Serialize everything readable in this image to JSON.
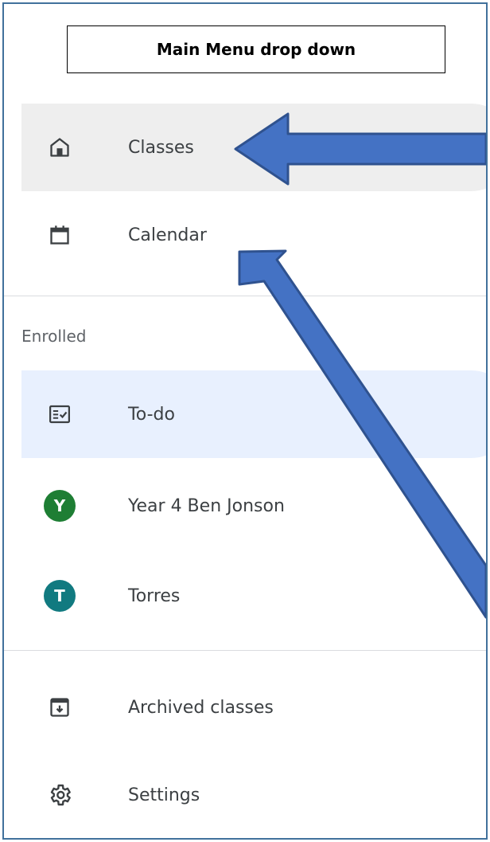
{
  "title": "Main Menu drop down",
  "menu": {
    "classes_label": "Classes",
    "calendar_label": "Calendar",
    "section_enrolled": "Enrolled",
    "todo_label": "To-do",
    "classes": [
      {
        "initial": "Y",
        "name": "Year 4 Ben Jonson",
        "color": "#1e7e34"
      },
      {
        "initial": "T",
        "name": "Torres",
        "color": "#117a80"
      }
    ],
    "archived_label": "Archived classes",
    "settings_label": "Settings"
  },
  "colors": {
    "annotation_arrow": "#4472c4",
    "annotation_arrow_border": "#2f528f",
    "active_row": "#eeeeee",
    "selected_row": "#e8f0fe",
    "icon": "#3c4043"
  },
  "icons": [
    "home-icon",
    "calendar-icon",
    "todo-icon",
    "archive-icon",
    "gear-icon"
  ]
}
